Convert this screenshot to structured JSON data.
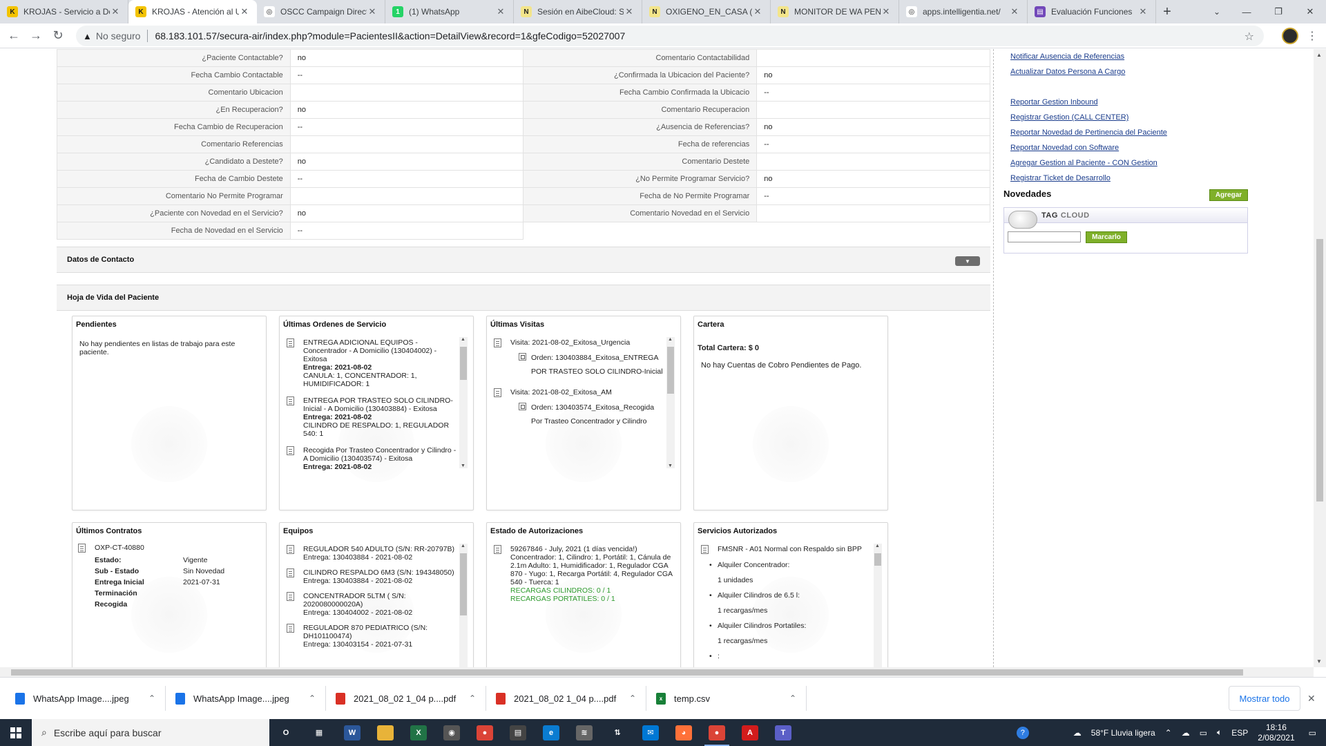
{
  "browser": {
    "tabs": [
      {
        "title": "KROJAS - Servicio a Do",
        "fav_color": "#f3c300",
        "fav_glyph": "K",
        "active": false
      },
      {
        "title": "KROJAS - Atención al U",
        "fav_color": "#f3c300",
        "fav_glyph": "K",
        "active": true
      },
      {
        "title": "OSCC Campaign Direct",
        "fav_color": "#ffffff",
        "fav_glyph": "◎",
        "active": false
      },
      {
        "title": "(1) WhatsApp",
        "fav_color": "#25d366",
        "fav_glyph": "1",
        "active": false
      },
      {
        "title": "Sesión en AibeCloud: S",
        "fav_color": "#f3e58a",
        "fav_glyph": "N",
        "active": false
      },
      {
        "title": "OXIGENO_EN_CASA (S",
        "fav_color": "#f3e58a",
        "fav_glyph": "N",
        "active": false
      },
      {
        "title": "MONITOR DE WA PEN",
        "fav_color": "#f3e58a",
        "fav_glyph": "N",
        "active": false
      },
      {
        "title": "apps.intelligentia.net/",
        "fav_color": "#ffffff",
        "fav_glyph": "◎",
        "active": false
      },
      {
        "title": "Evaluación Funciones",
        "fav_color": "#7248b9",
        "fav_glyph": "▤",
        "active": false
      }
    ],
    "insecure_label": "No seguro",
    "url": "68.183.101.57/secura-air/index.php?module=PacientesII&action=DetailView&record=1&gfeCodigo=52027007"
  },
  "detail_rows": [
    {
      "l1": "¿Paciente Contactable?",
      "v1": "no",
      "l2": "Comentario Contactabilidad",
      "v2": ""
    },
    {
      "l1": "Fecha Cambio Contactable",
      "v1": "--",
      "l2": "¿Confirmada la Ubicacion del Paciente?",
      "v2": "no"
    },
    {
      "l1": "Comentario Ubicacion",
      "v1": "",
      "l2": "Fecha Cambio Confirmada la Ubicacio",
      "v2": "--"
    },
    {
      "l1": "¿En Recuperacion?",
      "v1": "no",
      "l2": "Comentario Recuperacion",
      "v2": ""
    },
    {
      "l1": "Fecha Cambio de Recuperacion",
      "v1": "--",
      "l2": "¿Ausencia de Referencias?",
      "v2": "no"
    },
    {
      "l1": "Comentario Referencias",
      "v1": "",
      "l2": "Fecha de referencias",
      "v2": "--"
    },
    {
      "l1": "¿Candidato a Destete?",
      "v1": "no",
      "l2": "Comentario Destete",
      "v2": ""
    },
    {
      "l1": "Fecha de Cambio Destete",
      "v1": "--",
      "l2": "¿No Permite Programar Servicio?",
      "v2": "no"
    },
    {
      "l1": "Comentario No Permite Programar",
      "v1": "",
      "l2": "Fecha de No Permite Programar",
      "v2": "--"
    },
    {
      "l1": "¿Paciente con Novedad en el Servicio?",
      "v1": "no",
      "l2": "Comentario Novedad en el Servicio",
      "v2": ""
    },
    {
      "l1": "Fecha de Novedad en el Servicio",
      "v1": "--"
    }
  ],
  "sections": {
    "contacto": "Datos de Contacto",
    "hoja_vida": "Hoja de Vida del Paciente"
  },
  "panels": {
    "pendientes": {
      "title": "Pendientes",
      "text": "No hay pendientes en listas de trabajo para este paciente."
    },
    "ordenes": {
      "title": "Últimas Ordenes de Servicio",
      "items": [
        {
          "desc": "ENTREGA ADICIONAL EQUIPOS - Concentrador - A Domicilio (130404002) - Exitosa",
          "entrega": "Entrega: 2021-08-02",
          "detail": "CANULA: 1, CONCENTRADOR: 1, HUMIDIFICADOR: 1"
        },
        {
          "desc": "ENTREGA POR TRASTEO SOLO CILINDRO-Inicial - A Domicilio (130403884) - Exitosa",
          "entrega": "Entrega: 2021-08-02",
          "detail": "CILINDRO DE RESPALDO: 1, REGULADOR 540: 1"
        },
        {
          "desc": "Recogida Por Trasteo Concentrador y Cilindro - A Domicilio (130403574) - Exitosa",
          "entrega": "Entrega: 2021-08-02",
          "detail": ""
        }
      ]
    },
    "visitas": {
      "title": "Últimas Visitas",
      "items": [
        {
          "visita": "Visita: 2021-08-02_Exitosa_Urgencia",
          "orden_label": "Orden:",
          "orden": "130403884_Exitosa_ENTREGA POR TRASTEO SOLO CILINDRO-Inicial"
        },
        {
          "visita": "Visita: 2021-08-02_Exitosa_AM",
          "orden_label": "Orden:",
          "orden": "130403574_Exitosa_Recogida Por Trasteo Concentrador y Cilindro"
        }
      ]
    },
    "cartera": {
      "title": "Cartera",
      "total": "Total Cartera: $ 0",
      "text": "No hay Cuentas de Cobro Pendientes de Pago."
    },
    "contratos": {
      "title": "Últimos Contratos",
      "code": "OXP-CT-40880",
      "rows": [
        {
          "k": "Estado:",
          "v": "Vigente"
        },
        {
          "k": "Sub - Estado",
          "v": "Sin Novedad"
        },
        {
          "k": "Entrega Inicial",
          "v": "2021-07-31"
        },
        {
          "k": "Terminación",
          "v": ""
        },
        {
          "k": "Recogida",
          "v": ""
        }
      ]
    },
    "equipos": {
      "title": "Equipos",
      "items": [
        {
          "name": "REGULADOR 540 ADULTO (S/N: RR-20797B)",
          "entrega": "Entrega: 130403884 - 2021-08-02"
        },
        {
          "name": "CILINDRO RESPALDO 6M3 (S/N: 194348050)",
          "entrega": "Entrega: 130403884 - 2021-08-02"
        },
        {
          "name": "CONCENTRADOR 5LTM ( S/N: 2020080000020A)",
          "entrega": "Entrega: 130404002 - 2021-08-02"
        },
        {
          "name": "REGULADOR 870 PEDIATRICO (S/N: DH101100474)",
          "entrega": "Entrega: 130403154 - 2021-07-31"
        }
      ]
    },
    "autorizaciones": {
      "title": "Estado de Autorizaciones",
      "main": "59267846 - July, 2021 (1 días vencida!)",
      "detail": "Concentrador: 1, Cilindro: 1, Portátil: 1, Cánula de 2.1m Adulto: 1, Humidificador: 1, Regulador CGA 870 - Yugo: 1, Recarga Portátil: 4, Regulador CGA 540 - Tuerca: 1",
      "recargas_cil": "RECARGAS CILINDROS: 0 / 1",
      "recargas_port": "RECARGAS PORTATILES: 0 / 1"
    },
    "servicios": {
      "title": "Servicios Autorizados",
      "plan": "FMSNR - A01 Normal con Respaldo sin BPP",
      "items": [
        {
          "name": "Alquiler Concentrador:",
          "qty": "1 unidades"
        },
        {
          "name": "Alquiler Cilindros de 6.5 l:",
          "qty": "1 recargas/mes"
        },
        {
          "name": "Alquiler Cilindros Portatiles:",
          "qty": "1 recargas/mes"
        }
      ],
      "more": ":"
    }
  },
  "side_links": [
    "Notificar Ausencia de Referencias",
    "Actualizar Datos Persona A Cargo",
    "",
    "Reportar Gestion Inbound",
    "Registrar Gestion (CALL CENTER)",
    "Reportar Novedad de Pertinencia del Paciente",
    "Reportar Novedad con Software",
    "Agregar Gestion al Paciente - CON Gestion",
    "Registrar Ticket de Desarrollo"
  ],
  "novedades": {
    "title": "Novedades",
    "agregar": "Agregar",
    "tag": "TAG",
    "cloud": "CLOUD",
    "marcarlo": "Marcarlo"
  },
  "downloads": [
    {
      "name": "WhatsApp Image....jpeg",
      "color": "#1a73e8",
      "glyph": ""
    },
    {
      "name": "WhatsApp Image....jpeg",
      "color": "#1a73e8",
      "glyph": ""
    },
    {
      "name": "2021_08_02 1_04 p....pdf",
      "color": "#d93025",
      "glyph": ""
    },
    {
      "name": "2021_08_02 1_04 p....pdf",
      "color": "#d93025",
      "glyph": ""
    },
    {
      "name": "temp.csv",
      "color": "#188038",
      "glyph": "x"
    }
  ],
  "show_all": "Mostrar todo",
  "taskbar": {
    "search_placeholder": "Escribe aquí para buscar",
    "weather": "58°F  Lluvia ligera",
    "lang": "ESP",
    "time": "18:16",
    "date": "2/08/2021",
    "apps": [
      {
        "name": "task-view",
        "color": "transparent",
        "glyph": "O"
      },
      {
        "name": "widgets",
        "color": "transparent",
        "glyph": "▦"
      },
      {
        "name": "word",
        "color": "#2b579a",
        "glyph": "W"
      },
      {
        "name": "file-explorer",
        "color": "#e8b339",
        "glyph": ""
      },
      {
        "name": "excel",
        "color": "#217346",
        "glyph": "X"
      },
      {
        "name": "camera",
        "color": "#555",
        "glyph": "◉"
      },
      {
        "name": "chrome",
        "color": "#db4437",
        "glyph": "●"
      },
      {
        "name": "store",
        "color": "#444",
        "glyph": "▤"
      },
      {
        "name": "edge",
        "color": "#0a7cd1",
        "glyph": "e"
      },
      {
        "name": "app-gray",
        "color": "#666",
        "glyph": "≋"
      },
      {
        "name": "app-arrows",
        "color": "transparent",
        "glyph": "⇅"
      },
      {
        "name": "mail",
        "color": "#0078d4",
        "glyph": "✉"
      },
      {
        "name": "firefox",
        "color": "#ff7139",
        "glyph": "◕"
      },
      {
        "name": "chrome-active",
        "color": "#db4437",
        "glyph": "●"
      },
      {
        "name": "acrobat",
        "color": "#d21c1c",
        "glyph": "A"
      },
      {
        "name": "teams",
        "color": "#5b5fc7",
        "glyph": "T"
      }
    ]
  }
}
